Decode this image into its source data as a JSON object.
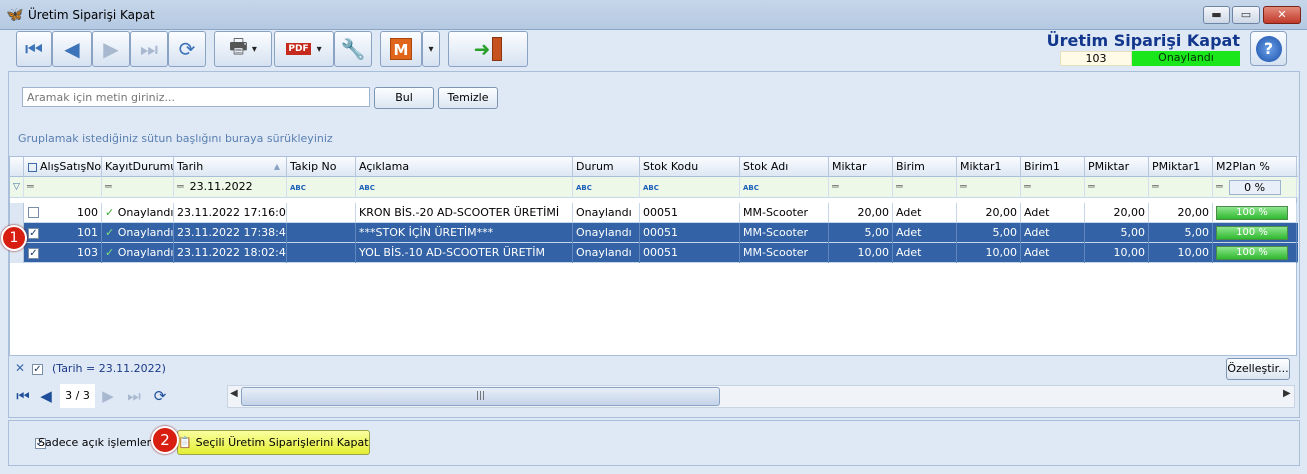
{
  "window": {
    "title": "Üretim Siparişi Kapat",
    "minimize": "▬",
    "maximize": "▭",
    "close": "✕"
  },
  "header": {
    "title": "Üretim Siparişi Kapat",
    "number": "103",
    "status": "Onaylandı",
    "status_color": "#1be51b"
  },
  "toolbar": {
    "first_icon": "⏮",
    "prev_icon": "◀",
    "next_icon": "▶",
    "last_icon": "⏭",
    "refresh_icon": "⟳",
    "print_icon": "🖶",
    "pdf_icon": "PDF",
    "tools_icon": "🔧",
    "m_label": "M",
    "dropdown": "▾",
    "exit_icon": "➜"
  },
  "help_label": "?",
  "search": {
    "placeholder": "Aramak için metin giriniz...",
    "find_label": "Bul",
    "clear_label": "Temizle"
  },
  "group_hint": "Gruplamak istediğiniz sütun başlığını buraya sürükleyiniz",
  "grid": {
    "columns": [
      "AlışSatışNo",
      "KayıtDurumu",
      "Tarih",
      "Takip No",
      "Açıklama",
      "Durum",
      "Stok Kodu",
      "Stok Adı",
      "Miktar",
      "Birim",
      "Miktar1",
      "Birim1",
      "PMiktar",
      "PMiktar1",
      "M2Plan %"
    ],
    "filter": {
      "date": "23.11.2022",
      "percent": "0 %"
    },
    "rows": [
      {
        "checked": "",
        "no": "100",
        "status": "Onaylandı",
        "date": "23.11.2022 17:16:08",
        "takip": "",
        "desc": "KRON BİS.-20 AD-SCOOTER ÜRETİMİ",
        "durum": "Onaylandı",
        "stok_kodu": "00051",
        "stok_adi": "MM-Scooter",
        "miktar": "20,00",
        "birim": "Adet",
        "miktar1": "20,00",
        "birim1": "Adet",
        "pmiktar": "20,00",
        "pmiktar1": "20,00",
        "plan": "100 %"
      },
      {
        "checked": "✓",
        "no": "101",
        "status": "Onaylandı",
        "date": "23.11.2022 17:38:40",
        "takip": "",
        "desc": "***STOK İÇİN ÜRETİM***",
        "durum": "Onaylandı",
        "stok_kodu": "00051",
        "stok_adi": "MM-Scooter",
        "miktar": "5,00",
        "birim": "Adet",
        "miktar1": "5,00",
        "birim1": "Adet",
        "pmiktar": "5,00",
        "pmiktar1": "5,00",
        "plan": "100 %"
      },
      {
        "checked": "✓",
        "no": "103",
        "status": "Onaylandı",
        "date": "23.11.2022 18:02:43",
        "takip": "",
        "desc": "YOL BİS.-10 AD-SCOOTER ÜRETİM",
        "durum": "Onaylandı",
        "stok_kodu": "00051",
        "stok_adi": "MM-Scooter",
        "miktar": "10,00",
        "birim": "Adet",
        "miktar1": "10,00",
        "birim1": "Adet",
        "pmiktar": "10,00",
        "pmiktar1": "10,00",
        "plan": "100 %"
      }
    ]
  },
  "active_filter": {
    "close": "✕",
    "check": "✓",
    "text": "(Tarih = 23.11.2022)",
    "customize_label": "Özelleştir..."
  },
  "navigator": {
    "first": "⏮",
    "prev": "◀",
    "next": "▶",
    "last": "⏭",
    "refresh": "⟳",
    "page": "3 / 3",
    "thumb": "|||",
    "left": "◀",
    "right": "▶"
  },
  "bottom": {
    "check": "✓",
    "only_open_label": "Sadece açık işlemleri göster",
    "close_selected_label": "Seçili Üretim Siparişlerini Kapat",
    "close_icon": "📋"
  },
  "badges": {
    "one": "1",
    "two": "2"
  }
}
